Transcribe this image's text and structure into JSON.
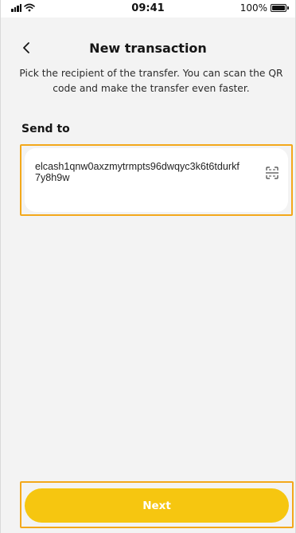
{
  "status_bar": {
    "time": "09:41",
    "battery": "100%"
  },
  "header": {
    "title": "New transaction",
    "subtitle": "Pick the recipient of the transfer. You can scan the QR code and make the transfer even faster."
  },
  "form": {
    "send_to_label": "Send to",
    "address_value": "elcash1qnw0axzmytrmpts96dwqyc3k6t6tdurkf7y8h9w"
  },
  "actions": {
    "next_label": "Next"
  },
  "icons": {
    "back": "chevron-left-icon",
    "scan": "qr-scan-icon"
  },
  "colors": {
    "accent": "#F6C610",
    "highlight": "#F3A81B",
    "background": "#F3F3F3"
  }
}
